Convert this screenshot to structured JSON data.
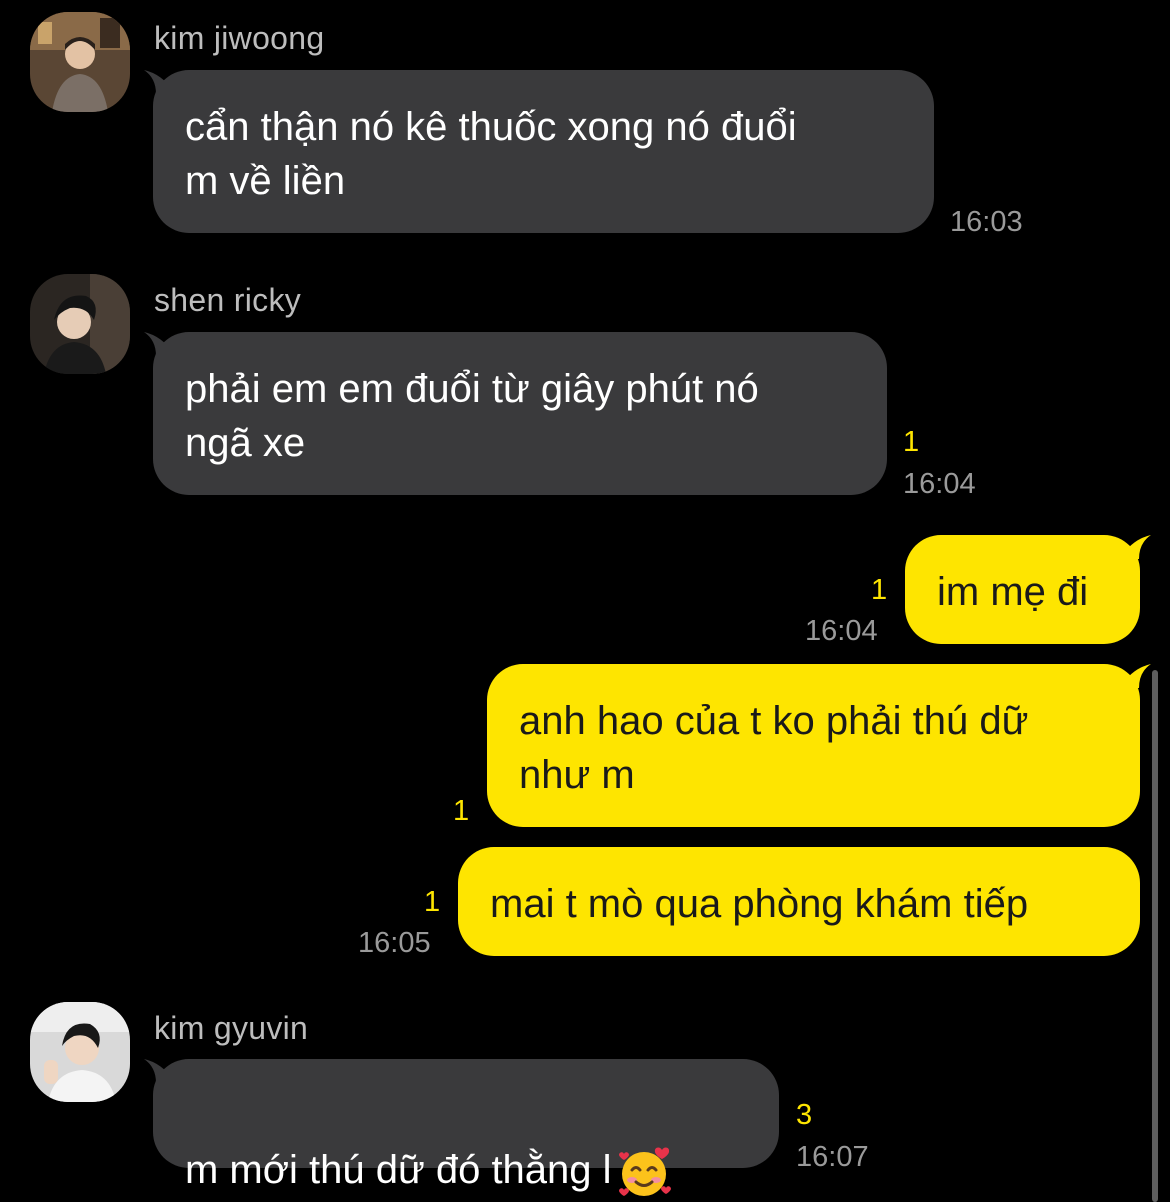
{
  "messages": [
    {
      "sender": "kim jiwoong",
      "text": "cẩn thận nó kê thuốc xong nó đuổi\nm về liền",
      "time": "16:03"
    },
    {
      "sender": "shen ricky",
      "text": "phải em em đuổi từ giây phút nó\nngã xe",
      "unread": "1",
      "time": "16:04"
    },
    {
      "text": "im mẹ đi",
      "unread": "1",
      "time": "16:04"
    },
    {
      "text": "anh hao của t ko phải thú dữ\nnhư m",
      "unread": "1"
    },
    {
      "text": "mai t mò qua phòng khám tiếp",
      "unread": "1",
      "time": "16:05"
    },
    {
      "sender": "kim gyuvin",
      "text": "m mới thú dữ đó thằng l",
      "emoji": "smiling-face-with-hearts",
      "unread": "3",
      "time": "16:07"
    }
  ],
  "colors": {
    "background": "#000000",
    "incoming_bubble": "#3a3a3c",
    "outgoing_bubble": "#fee500",
    "unread_count": "#fee500",
    "timestamp": "#9a9a9a",
    "sender_name": "#bdbdbd"
  }
}
